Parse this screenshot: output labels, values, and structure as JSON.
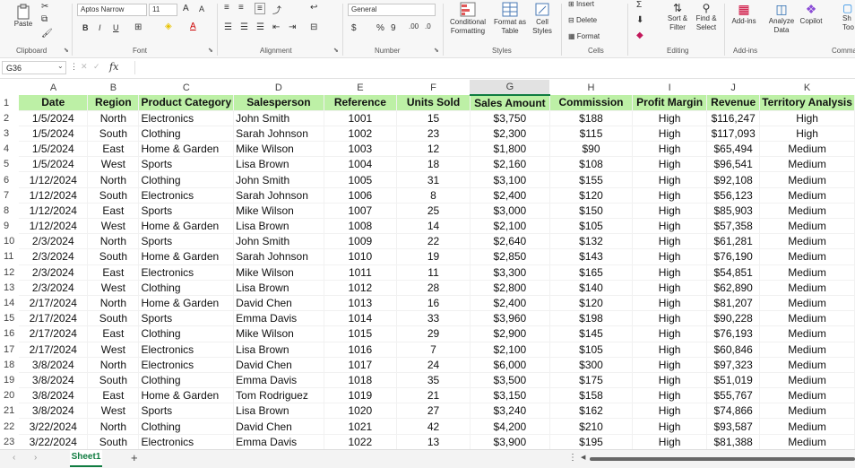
{
  "ribbon": {
    "clipboard": {
      "label": "Clipboard",
      "paste": "Paste"
    },
    "font": {
      "label": "Font",
      "name": "Aptos Narrow",
      "size": "11",
      "grow": "A",
      "shrink": "A",
      "bold": "B",
      "italic": "I",
      "underline": "U"
    },
    "alignment": {
      "label": "Alignment"
    },
    "number": {
      "label": "Number",
      "format": "General",
      "currency": "$",
      "percent": "%",
      "comma": "9"
    },
    "styles": {
      "label": "Styles",
      "conditional": "Conditional Formatting",
      "format_table": "Format as Table",
      "cell_styles": "Cell Styles"
    },
    "cells": {
      "label": "Cells",
      "insert": "Insert",
      "delete": "Delete",
      "format": "Format"
    },
    "editing": {
      "label": "Editing",
      "sort": "Sort & Filter",
      "find": "Find & Select"
    },
    "addins": {
      "label": "Add-ins",
      "addins": "Add-ins",
      "analyze": "Analyze Data",
      "copilot": "Copilot",
      "comments_label": "Comma",
      "show": "Sh",
      "tools": "Too"
    }
  },
  "formula_bar": {
    "cell_ref": "G36",
    "fx": "fx",
    "value": ""
  },
  "sheet": {
    "columns": [
      "A",
      "B",
      "C",
      "D",
      "E",
      "F",
      "G",
      "H",
      "I",
      "J",
      "K"
    ],
    "selected_column": "G",
    "headers": [
      "Date",
      "Region",
      "Product Category",
      "Salesperson",
      "Reference",
      "Units Sold",
      "Sales Amount",
      "Commission",
      "Profit Margin",
      "Revenue",
      "Territory Analysis"
    ],
    "rows": [
      [
        "1/5/2024",
        "North",
        "Electronics",
        "John Smith",
        "1001",
        "15",
        "$3,750",
        "$188",
        "High",
        "$116,247",
        "High"
      ],
      [
        "1/5/2024",
        "South",
        "Clothing",
        "Sarah Johnson",
        "1002",
        "23",
        "$2,300",
        "$115",
        "High",
        "$117,093",
        "High"
      ],
      [
        "1/5/2024",
        "East",
        "Home & Garden",
        "Mike Wilson",
        "1003",
        "12",
        "$1,800",
        "$90",
        "High",
        "$65,494",
        "Medium"
      ],
      [
        "1/5/2024",
        "West",
        "Sports",
        "Lisa Brown",
        "1004",
        "18",
        "$2,160",
        "$108",
        "High",
        "$96,541",
        "Medium"
      ],
      [
        "1/12/2024",
        "North",
        "Clothing",
        "John Smith",
        "1005",
        "31",
        "$3,100",
        "$155",
        "High",
        "$92,108",
        "Medium"
      ],
      [
        "1/12/2024",
        "South",
        "Electronics",
        "Sarah Johnson",
        "1006",
        "8",
        "$2,400",
        "$120",
        "High",
        "$56,123",
        "Medium"
      ],
      [
        "1/12/2024",
        "East",
        "Sports",
        "Mike Wilson",
        "1007",
        "25",
        "$3,000",
        "$150",
        "High",
        "$85,903",
        "Medium"
      ],
      [
        "1/12/2024",
        "West",
        "Home & Garden",
        "Lisa Brown",
        "1008",
        "14",
        "$2,100",
        "$105",
        "High",
        "$57,358",
        "Medium"
      ],
      [
        "2/3/2024",
        "North",
        "Sports",
        "John Smith",
        "1009",
        "22",
        "$2,640",
        "$132",
        "High",
        "$61,281",
        "Medium"
      ],
      [
        "2/3/2024",
        "South",
        "Home & Garden",
        "Sarah Johnson",
        "1010",
        "19",
        "$2,850",
        "$143",
        "High",
        "$76,190",
        "Medium"
      ],
      [
        "2/3/2024",
        "East",
        "Electronics",
        "Mike Wilson",
        "1011",
        "11",
        "$3,300",
        "$165",
        "High",
        "$54,851",
        "Medium"
      ],
      [
        "2/3/2024",
        "West",
        "Clothing",
        "Lisa Brown",
        "1012",
        "28",
        "$2,800",
        "$140",
        "High",
        "$62,890",
        "Medium"
      ],
      [
        "2/17/2024",
        "North",
        "Home & Garden",
        "David Chen",
        "1013",
        "16",
        "$2,400",
        "$120",
        "High",
        "$81,207",
        "Medium"
      ],
      [
        "2/17/2024",
        "South",
        "Sports",
        "Emma Davis",
        "1014",
        "33",
        "$3,960",
        "$198",
        "High",
        "$90,228",
        "Medium"
      ],
      [
        "2/17/2024",
        "East",
        "Clothing",
        "Mike Wilson",
        "1015",
        "29",
        "$2,900",
        "$145",
        "High",
        "$76,193",
        "Medium"
      ],
      [
        "2/17/2024",
        "West",
        "Electronics",
        "Lisa Brown",
        "1016",
        "7",
        "$2,100",
        "$105",
        "High",
        "$60,846",
        "Medium"
      ],
      [
        "3/8/2024",
        "North",
        "Electronics",
        "David Chen",
        "1017",
        "24",
        "$6,000",
        "$300",
        "High",
        "$97,323",
        "Medium"
      ],
      [
        "3/8/2024",
        "South",
        "Clothing",
        "Emma Davis",
        "1018",
        "35",
        "$3,500",
        "$175",
        "High",
        "$51,019",
        "Medium"
      ],
      [
        "3/8/2024",
        "East",
        "Home & Garden",
        "Tom Rodriguez",
        "1019",
        "21",
        "$3,150",
        "$158",
        "High",
        "$55,767",
        "Medium"
      ],
      [
        "3/8/2024",
        "West",
        "Sports",
        "Lisa Brown",
        "1020",
        "27",
        "$3,240",
        "$162",
        "High",
        "$74,866",
        "Medium"
      ],
      [
        "3/22/2024",
        "North",
        "Clothing",
        "David Chen",
        "1021",
        "42",
        "$4,200",
        "$210",
        "High",
        "$93,587",
        "Medium"
      ],
      [
        "3/22/2024",
        "South",
        "Electronics",
        "Emma Davis",
        "1022",
        "13",
        "$3,900",
        "$195",
        "High",
        "$81,388",
        "Medium"
      ]
    ]
  },
  "tabs": {
    "sheet1": "Sheet1",
    "add": "+"
  }
}
